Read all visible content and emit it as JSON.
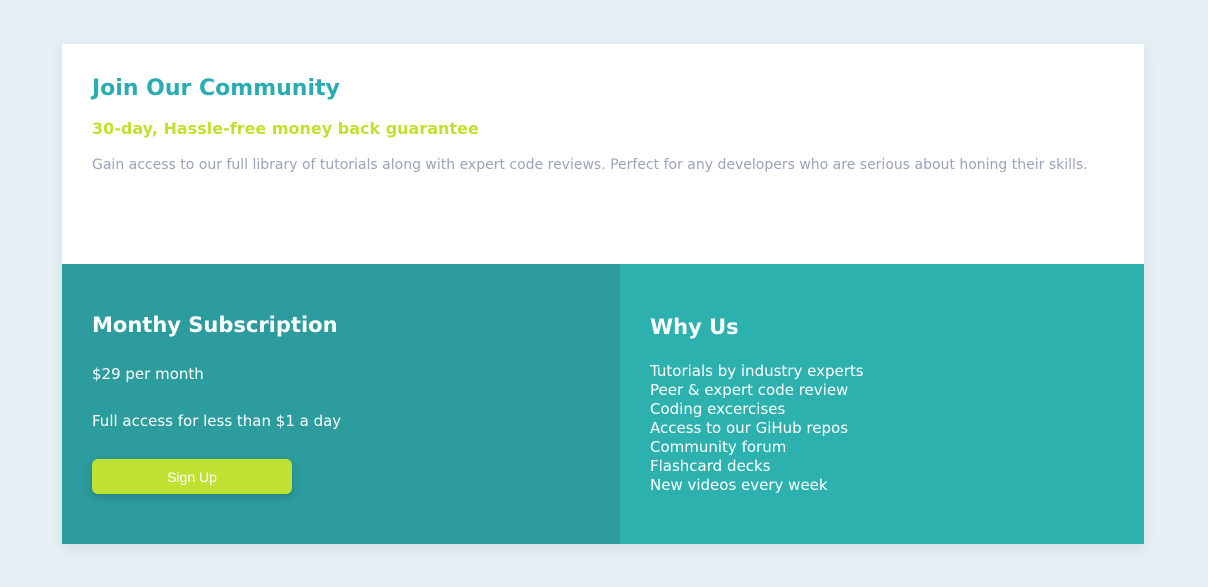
{
  "header": {
    "title": "Join Our Community",
    "guarantee": "30-day, Hassle-free money back guarantee",
    "description": "Gain access to our full library of tutorials along with expert code reviews. Perfect for any developers who are serious about honing their skills."
  },
  "subscription": {
    "title": "Monthy Subscription",
    "price": "$29 per month",
    "tagline": "Full access for less than $1 a day",
    "button_label": "Sign Up"
  },
  "why_us": {
    "title": "Why Us",
    "items": [
      "Tutorials by industry experts",
      "Peer & expert code review",
      "Coding excercises",
      "Access to our GiHub repos",
      "Community forum",
      "Flashcard decks",
      "New videos every week"
    ]
  },
  "colors": {
    "page_background": "#e6eef6",
    "title_teal": "#2aacb4",
    "guarantee_lime": "#bfe132",
    "description_gray": "#9ba3bb",
    "subscription_panel": "#2d9c9e",
    "why_us_panel": "#2cb1ae",
    "button_lime": "#bfe132"
  }
}
